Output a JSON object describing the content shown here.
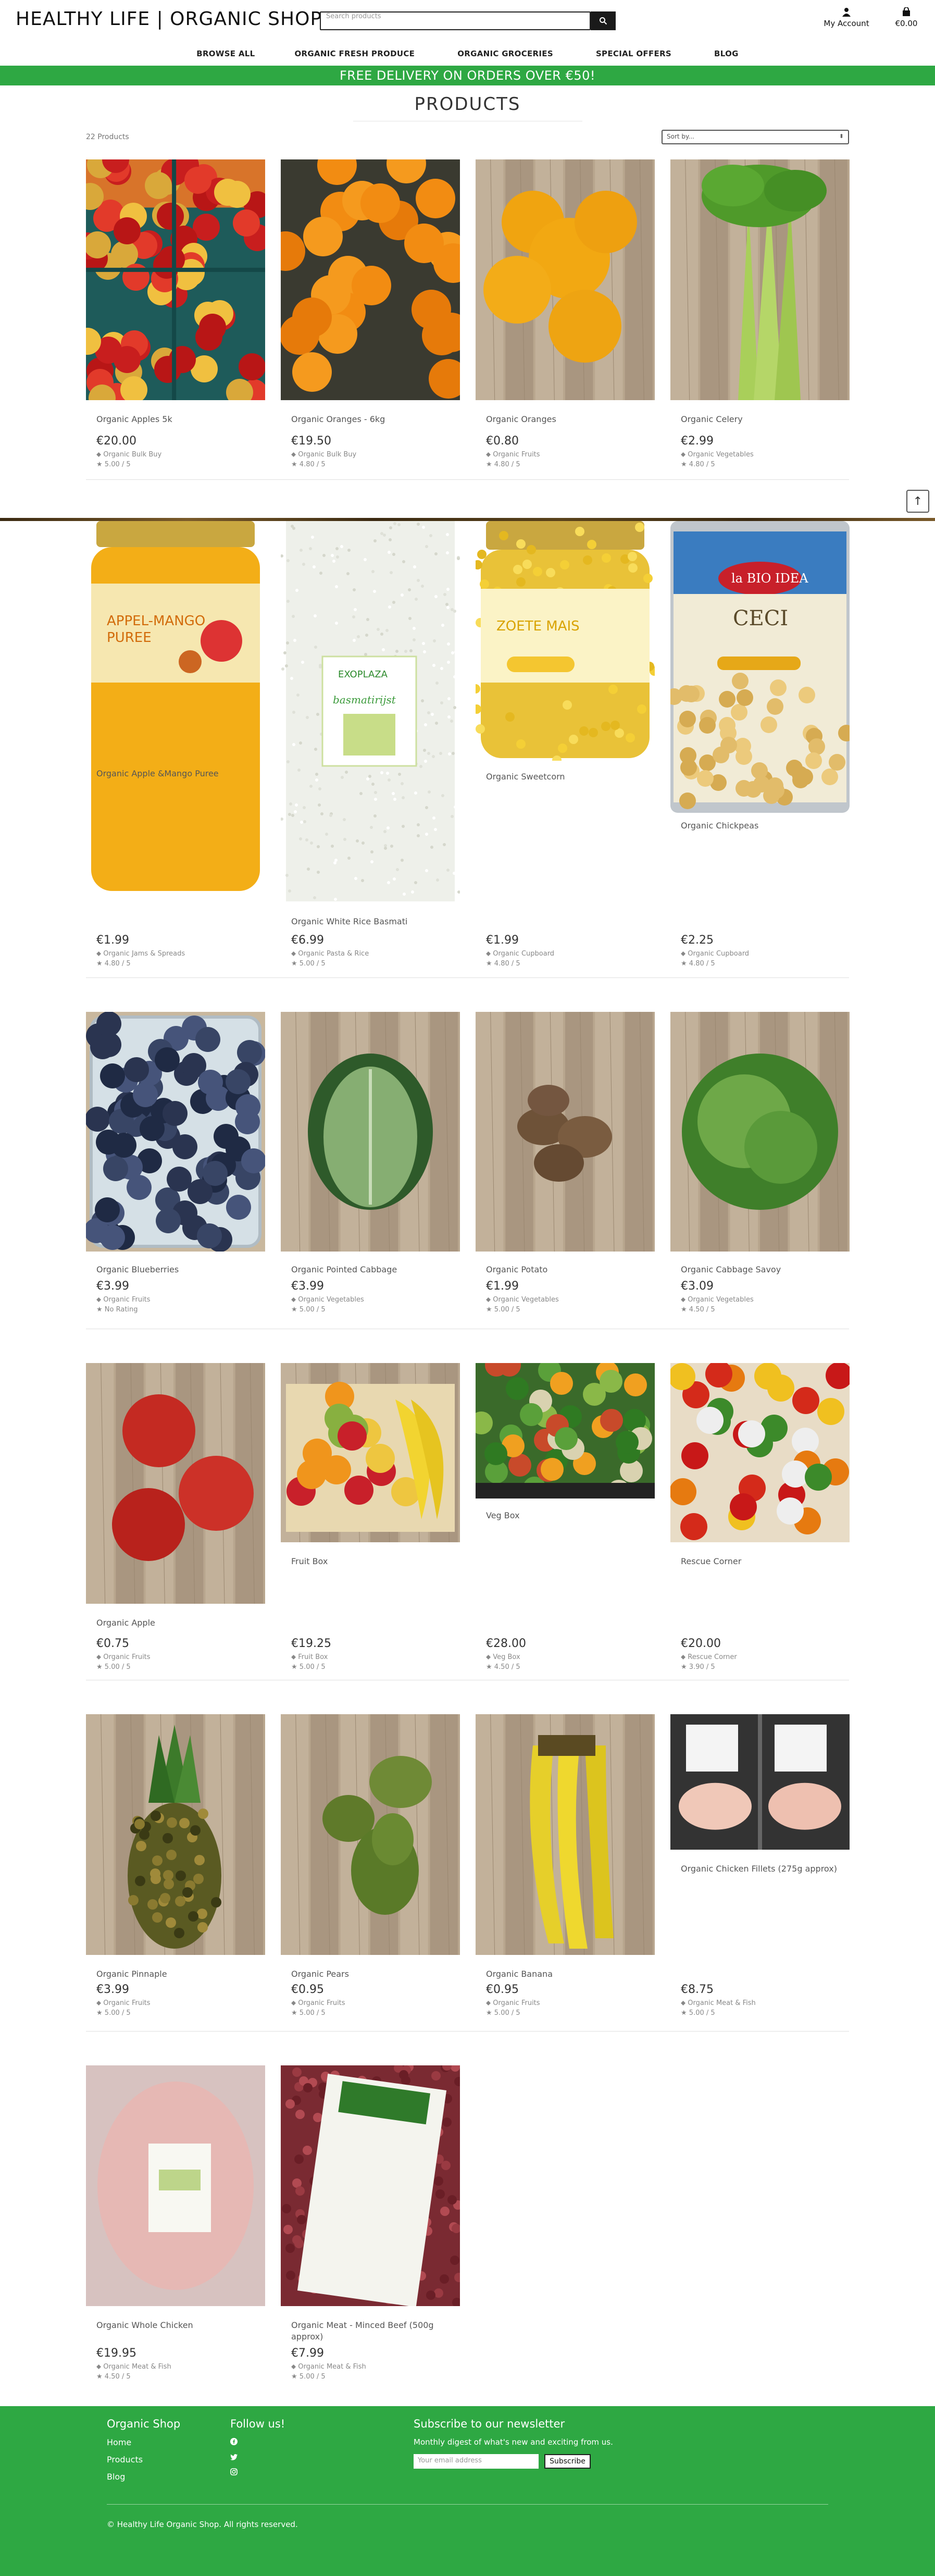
{
  "header": {
    "logo": "HEALTHY LIFE | ORGANIC SHOP",
    "search_placeholder": "Search products",
    "account_label": "My Account",
    "cart_total": "€0.00"
  },
  "nav": [
    {
      "label": "BROWSE ALL"
    },
    {
      "label": "ORGANIC FRESH PRODUCE"
    },
    {
      "label": "ORGANIC GROCERIES"
    },
    {
      "label": "SPECIAL OFFERS"
    },
    {
      "label": "BLOG"
    }
  ],
  "promo": "FREE DELIVERY ON ORDERS OVER €50!",
  "page_title": "PRODUCTS",
  "product_count": "22 Products",
  "sort_placeholder": "Sort by...",
  "products": [
    {
      "name": "Organic Apples 5k",
      "price": "€20.00",
      "category": "Organic Bulk Buy",
      "rating": "5.00 / 5",
      "image": "apples-crate"
    },
    {
      "name": "Organic Oranges - 6kg",
      "price": "€19.50",
      "category": "Organic Bulk Buy",
      "rating": "4.80 / 5",
      "image": "oranges-crate"
    },
    {
      "name": "Organic Oranges",
      "price": "€0.80",
      "category": "Organic Fruits",
      "rating": "4.80 / 5",
      "image": "oranges-wood"
    },
    {
      "name": "Organic Celery",
      "price": "€2.99",
      "category": "Organic Vegetables",
      "rating": "4.80 / 5",
      "image": "celery"
    },
    {
      "name": "Organic Apple &Mango Puree",
      "price": "€1.99",
      "category": "Organic Jams & Spreads",
      "rating": "4.80 / 5",
      "image": "puree-jar"
    },
    {
      "name": "Organic White Rice Basmati",
      "price": "€6.99",
      "category": "Organic Pasta & Rice",
      "rating": "5.00 / 5",
      "image": "rice-bag"
    },
    {
      "name": "Organic Sweetcorn",
      "price": "€1.99",
      "category": "Organic Cupboard",
      "rating": "4.80 / 5",
      "image": "corn-jar"
    },
    {
      "name": "Organic Chickpeas",
      "price": "€2.25",
      "category": "Organic Cupboard",
      "rating": "4.80 / 5",
      "image": "chickpea-can"
    },
    {
      "name": "Organic Blueberries",
      "price": "€3.99",
      "category": "Organic Fruits",
      "rating": "No Rating",
      "image": "blueberries"
    },
    {
      "name": "Organic Pointed Cabbage",
      "price": "€3.99",
      "category": "Organic Vegetables",
      "rating": "5.00 / 5",
      "image": "pointed-cabbage"
    },
    {
      "name": "Organic Potato",
      "price": "€1.99",
      "category": "Organic Vegetables",
      "rating": "5.00 / 5",
      "image": "potato"
    },
    {
      "name": "Organic Cabbage Savoy",
      "price": "€3.09",
      "category": "Organic Vegetables",
      "rating": "4.50 / 5",
      "image": "savoy"
    },
    {
      "name": "Organic Apple",
      "price": "€0.75",
      "category": "Organic Fruits",
      "rating": "5.00 / 5",
      "image": "apple-wood"
    },
    {
      "name": "Fruit Box",
      "price": "€19.25",
      "category": "Fruit Box",
      "rating": "5.00 / 5",
      "image": "fruit-box"
    },
    {
      "name": "Veg Box",
      "price": "€28.00",
      "category": "Veg Box",
      "rating": "4.50 / 5",
      "image": "veg-box"
    },
    {
      "name": "Rescue Corner",
      "price": "€20.00",
      "category": "Rescue Corner",
      "rating": "3.90 / 5",
      "image": "rescue"
    },
    {
      "name": "Organic Pinnaple",
      "price": "€3.99",
      "category": "Organic Fruits",
      "rating": "5.00 / 5",
      "image": "pineapple"
    },
    {
      "name": "Organic Pears",
      "price": "€0.95",
      "category": "Organic Fruits",
      "rating": "5.00 / 5",
      "image": "pears"
    },
    {
      "name": "Organic Banana",
      "price": "€0.95",
      "category": "Organic Fruits",
      "rating": "5.00 / 5",
      "image": "banana"
    },
    {
      "name": "Organic Chicken Fillets (275g approx)",
      "price": "€8.75",
      "category": "Organic Meat & Fish",
      "rating": "5.00 / 5",
      "image": "chicken-fillets"
    },
    {
      "name": "Organic Whole Chicken",
      "price": "€19.95",
      "category": "Organic Meat & Fish",
      "rating": "4.50 / 5",
      "image": "whole-chicken"
    },
    {
      "name": "Organic Meat - Minced Beef (500g approx)",
      "price": "€7.99",
      "category": "Organic Meat & Fish",
      "rating": "5.00 / 5",
      "image": "minced-beef"
    }
  ],
  "footer": {
    "col1_title": "Organic Shop",
    "links": [
      "Home",
      "Products",
      "Blog"
    ],
    "col2_title": "Follow us!",
    "social": [
      "facebook-icon",
      "twitter-icon",
      "instagram-icon"
    ],
    "newsletter_title": "Subscribe to our newsletter",
    "newsletter_text": "Monthly digest of what's new and exciting from us.",
    "email_placeholder": "Your email address",
    "subscribe_label": "Subscribe",
    "copyright": "© Healthy Life Organic Shop. All rights reserved."
  },
  "colors": {
    "brand_green": "#2ea843",
    "text": "#333333"
  }
}
